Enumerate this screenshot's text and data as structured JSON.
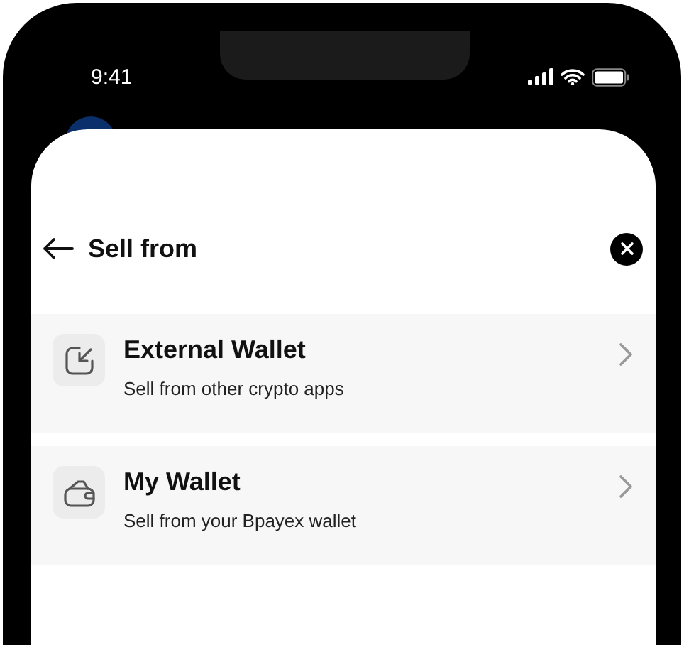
{
  "status_bar": {
    "time": "9:41"
  },
  "sheet": {
    "title": "Sell from",
    "options": [
      {
        "kind": "external",
        "title": "External Wallet",
        "subtitle": "Sell from other crypto apps"
      },
      {
        "kind": "wallet",
        "title": "My Wallet",
        "subtitle": "Sell from your Bpayex wallet"
      }
    ]
  }
}
